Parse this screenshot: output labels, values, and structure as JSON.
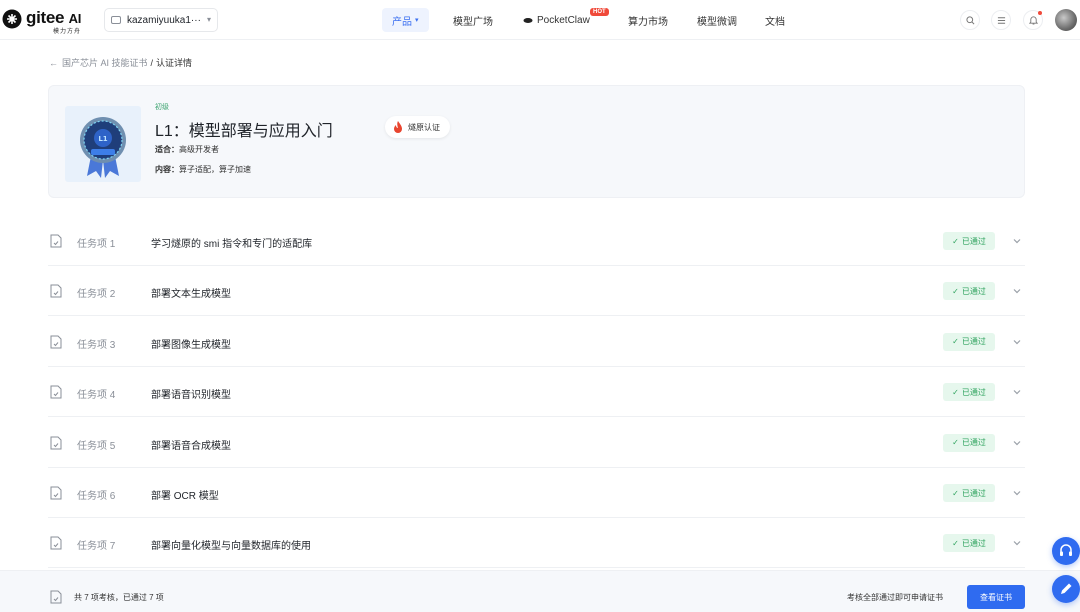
{
  "brand": {
    "name": "gitee",
    "ai": "AI",
    "sub": "模力方舟"
  },
  "account": {
    "name": "kazamiyuuka1···"
  },
  "nav": {
    "items": [
      {
        "label": "产品",
        "active": true
      },
      {
        "label": "模型广场"
      },
      {
        "label": "PocketClaw",
        "badge": "HOT"
      },
      {
        "label": "算力市场"
      },
      {
        "label": "模型微调"
      },
      {
        "label": "文档"
      }
    ]
  },
  "breadcrumb": {
    "parent": "国产芯片 AI 技能证书",
    "separator": "/",
    "current": "认证详情"
  },
  "course": {
    "level": "初级",
    "title": "L1：模型部署与应用入门",
    "tag": "燧原认证",
    "suitable_label": "适合：",
    "suitable_value": "高级开发者",
    "content_label": "内容：",
    "content_value": "算子适配，算子加速"
  },
  "tasks": [
    {
      "no": "任务项 1",
      "name": "学习燧原的 smi 指令和专门的适配库",
      "status": "已通过"
    },
    {
      "no": "任务项 2",
      "name": "部署文本生成模型",
      "status": "已通过"
    },
    {
      "no": "任务项 3",
      "name": "部署图像生成模型",
      "status": "已通过"
    },
    {
      "no": "任务项 4",
      "name": "部署语音识别模型",
      "status": "已通过"
    },
    {
      "no": "任务项 5",
      "name": "部署语音合成模型",
      "status": "已通过"
    },
    {
      "no": "任务项 6",
      "name": "部署 OCR 模型",
      "status": "已通过"
    },
    {
      "no": "任务项 7",
      "name": "部署向量化模型与向量数据库的使用",
      "status": "已通过"
    }
  ],
  "footer": {
    "summary": "共 7 项考核，已通过 7 项",
    "hint": "考核全部通过即可申请证书",
    "button": "查看证书"
  },
  "colors": {
    "accent": "#2f6bf0",
    "success": "#2fa35e",
    "success_bg": "#e6f7ed",
    "hot": "#f04a3a"
  }
}
